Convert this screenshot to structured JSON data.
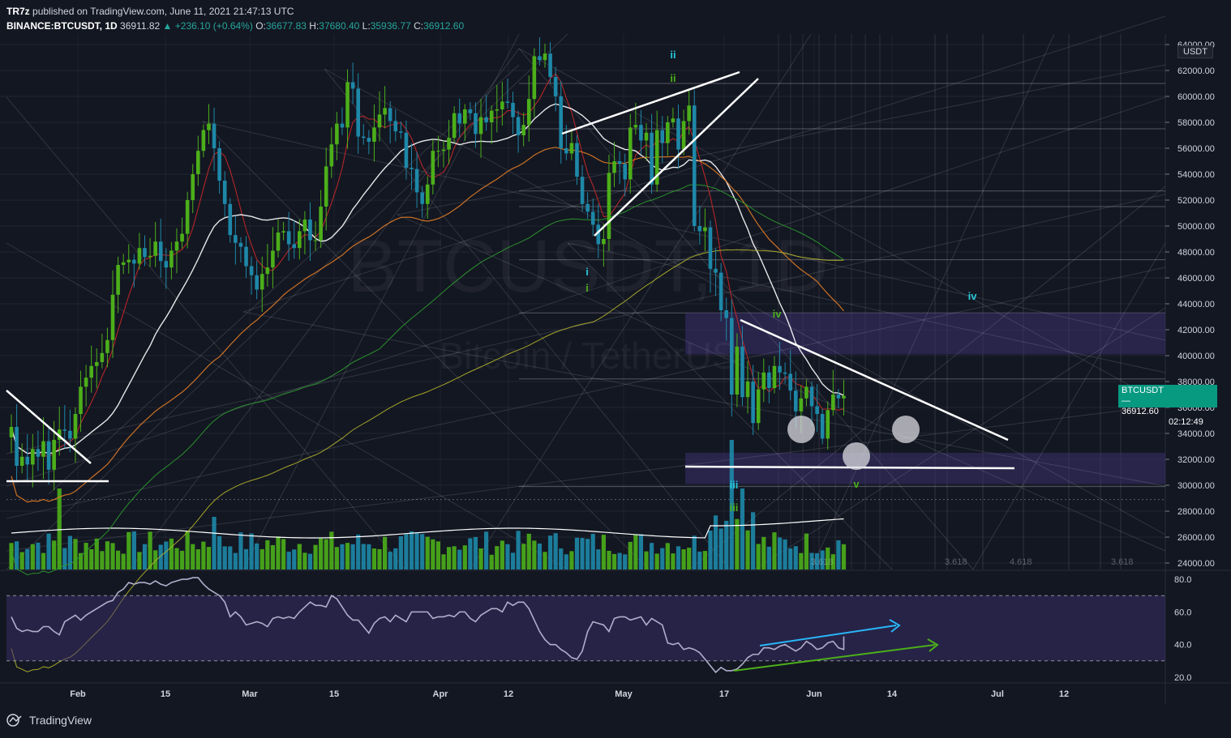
{
  "header": {
    "publisher": "TR7z",
    "published_text": "published on TradingView.com, June 11, 2021 21:47:13 UTC",
    "symbol": "BINANCE:BTCUSDT, 1D",
    "last": "36911.82",
    "change": "+236.10 (+0.64%)",
    "o_label": "O:",
    "o": "36677.83",
    "h_label": "H:",
    "h": "37680.40",
    "l_label": "L:",
    "l": "35936.77",
    "c_label": "C:",
    "c": "36912.60"
  },
  "watermark": {
    "line1": "BTCUSDT, 1D",
    "line2": "Bitcoin / TetherUS"
  },
  "price_tag": {
    "symbol": "BTCUSDT",
    "price": "36912.60",
    "countdown": "02:12:49"
  },
  "unit_label": "USDT",
  "footer": {
    "brand": "TradingView"
  },
  "colors": {
    "background": "#131722",
    "bull": "#4caf1a",
    "bear": "#1e88a8",
    "ma_fast": "#c62828",
    "ma_mid": "#ffffff",
    "ma_slow": "#e07b24",
    "ma_long": "#2e9e2e",
    "ma_200": "#b5b52a",
    "zone": "#3b2f6b",
    "rsi": "#b0aecb"
  },
  "chart_data": {
    "type": "candlestick",
    "symbol": "BINANCE:BTCUSDT",
    "timeframe": "1D",
    "y_axis": {
      "range": [
        23500,
        64500
      ],
      "ticks": [
        24000,
        26000,
        28000,
        30000,
        32000,
        34000,
        36000,
        38000,
        40000,
        42000,
        44000,
        46000,
        48000,
        50000,
        52000,
        54000,
        56000,
        58000,
        60000,
        62000,
        64000
      ]
    },
    "x_axis": {
      "ticks": [
        "Feb",
        "15",
        "Mar",
        "15",
        "Apr",
        "12",
        "May",
        "17",
        "Jun",
        "14",
        "Jul",
        "12"
      ]
    },
    "close_series": [
      34500,
      31500,
      32200,
      31600,
      32800,
      32200,
      33400,
      31200,
      33500,
      34300,
      34200,
      33600,
      35500,
      37600,
      38300,
      39200,
      39500,
      40200,
      41200,
      44700,
      47000,
      47200,
      47400,
      47100,
      48300,
      47600,
      47700,
      48800,
      47300,
      46800,
      48100,
      48800,
      49400,
      52000,
      54000,
      55800,
      57400,
      57900,
      56000,
      53500,
      51700,
      49300,
      48700,
      48400,
      46900,
      46200,
      45100,
      46300,
      46800,
      48100,
      49500,
      49600,
      48600,
      48300,
      49600,
      50500,
      48900,
      48900,
      51500,
      54600,
      56300,
      57900,
      57600,
      61100,
      60600,
      56900,
      56800,
      56500,
      57600,
      58600,
      59100,
      58100,
      57300,
      57200,
      54500,
      54400,
      52600,
      51700,
      53200,
      55800,
      55800,
      55900,
      56800,
      58700,
      57900,
      59000,
      58700,
      57100,
      58400,
      58000,
      58900,
      59000,
      59600,
      59500,
      58400,
      57000,
      57800,
      59800,
      63100,
      62800,
      63300,
      61500,
      60000,
      56000,
      55600,
      56400,
      53800,
      51700,
      51100,
      50100,
      48600,
      49000,
      54100,
      55000,
      54800,
      53600,
      57600,
      57800,
      56600,
      57200,
      53200,
      57400,
      56400,
      58000,
      58300,
      55900,
      58100,
      59300,
      50000,
      49600,
      49900,
      46700,
      46400,
      43500,
      42900,
      37000,
      40700,
      36800,
      38000,
      34800,
      37400,
      38700,
      37500,
      39200,
      38700,
      38600,
      37300,
      35700,
      36700,
      37600,
      36100,
      35500,
      33600,
      35800,
      37000,
      36700,
      36900
    ],
    "volume_axis_range": [
      0,
      100
    ],
    "moving_averages": [
      {
        "color": "#c62828",
        "period_hint": "fast"
      },
      {
        "color": "#ffffff",
        "period_hint": "mid"
      },
      {
        "color": "#e07b24",
        "period_hint": "slow"
      },
      {
        "color": "#2e9e2e",
        "period_hint": "long"
      }
    ],
    "fib_labels": [
      "3.618",
      "3.618",
      "4.618",
      "3.618"
    ],
    "wave_labels": [
      "ii",
      "ii",
      "i",
      "i",
      "iv",
      "iii",
      "iii",
      "v",
      "iv"
    ],
    "zones": [
      {
        "from": 40100,
        "to": 43300
      },
      {
        "from": 30100,
        "to": 32500
      }
    ],
    "rsi": {
      "range": [
        17,
        85
      ],
      "ticks": [
        20,
        40,
        60,
        80
      ],
      "levels": [
        30,
        70
      ],
      "values": [
        57,
        50,
        48,
        49,
        48,
        48,
        51,
        51,
        48,
        46,
        54,
        56,
        58,
        55,
        58,
        60,
        62,
        64,
        66,
        67,
        72,
        74,
        78,
        77,
        78,
        78,
        77,
        79,
        77,
        76,
        78,
        79,
        80,
        80,
        81,
        81,
        77,
        74,
        72,
        70,
        66,
        57,
        60,
        57,
        52,
        53,
        54,
        53,
        51,
        56,
        57,
        56,
        57,
        56,
        60,
        63,
        66,
        64,
        64,
        63,
        70,
        68,
        63,
        58,
        55,
        55,
        51,
        47,
        53,
        56,
        57,
        54,
        58,
        56,
        54,
        60,
        60,
        60,
        60,
        56,
        57,
        57,
        58,
        57,
        60,
        60,
        56,
        54,
        58,
        60,
        62,
        62,
        60,
        66,
        64,
        66,
        66,
        62,
        55,
        48,
        43,
        40,
        40,
        37,
        35,
        32,
        31,
        36,
        48,
        54,
        53,
        52,
        48,
        56,
        57,
        57,
        55,
        56,
        57,
        52,
        56,
        54,
        52,
        41,
        40,
        41,
        37,
        38,
        37,
        35,
        31,
        27,
        23,
        26,
        24,
        24,
        25,
        28,
        32,
        34,
        34,
        38,
        38,
        37,
        39,
        40,
        38,
        36,
        38,
        42,
        40,
        37,
        38,
        41,
        42,
        38,
        37,
        39,
        44,
        44,
        45
      ]
    }
  }
}
